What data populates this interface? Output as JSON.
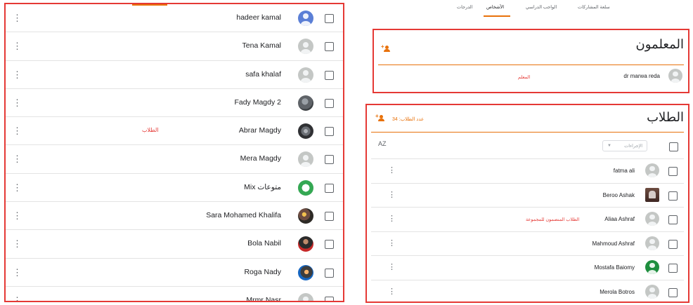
{
  "colors": {
    "annotation_border": "#e53935",
    "accent": "#e8710a"
  },
  "tabs": [
    {
      "label": "سلعة المشاركات",
      "active": false
    },
    {
      "label": "الواجب الدراسي",
      "active": false
    },
    {
      "label": "الأشخاص",
      "active": true
    },
    {
      "label": "الدرجات",
      "active": false
    }
  ],
  "left_list": {
    "note": "الطلاب",
    "rows": [
      {
        "name": "hadeer kamal",
        "avatar": "blue-default-avatar"
      },
      {
        "name": "Tena Kamal",
        "avatar": "default-avatar"
      },
      {
        "name": "safa khalaf",
        "avatar": "default-avatar"
      },
      {
        "name": "Fady Magdy 2",
        "avatar": "photo-avatar"
      },
      {
        "name": "Abrar Magdy",
        "avatar": "photo-avatar"
      },
      {
        "name": "Mera Magdy",
        "avatar": "default-avatar"
      },
      {
        "name": "Mix متوعات",
        "avatar": "logo-avatar"
      },
      {
        "name": "Sara Mohamed Khalifa",
        "avatar": "photo-avatar"
      },
      {
        "name": "Bola Nabil",
        "avatar": "photo-avatar"
      },
      {
        "name": "Roga Nady",
        "avatar": "photo-avatar"
      },
      {
        "name": "Mrmr Nasr",
        "avatar": "default-avatar"
      }
    ]
  },
  "teachers": {
    "title": "المعلمون",
    "note": "المعلم",
    "rows": [
      {
        "name": "dr marwa reda",
        "avatar": "default-avatar"
      }
    ]
  },
  "students": {
    "title": "الطلاب",
    "count_label": "عدد الطلاب: 34",
    "actions_placeholder": "الإجراءات",
    "sort_icon": "AZ",
    "group_note": "الطلاب المنضمون للمجموعة",
    "rows": [
      {
        "name": "fatma ali",
        "avatar": "default-avatar"
      },
      {
        "name": "Beroo Ashak",
        "avatar": "square-photo-avatar"
      },
      {
        "name": "Aliaa Ashraf",
        "avatar": "default-avatar"
      },
      {
        "name": "Mahmoud Ashraf",
        "avatar": "default-avatar"
      },
      {
        "name": "Mostafa Baiomy",
        "avatar": "green-default-avatar"
      },
      {
        "name": "Merola Botros",
        "avatar": "default-avatar"
      }
    ]
  },
  "icons": {
    "kebab": "⋮",
    "caret": "▼",
    "plus": "+"
  }
}
